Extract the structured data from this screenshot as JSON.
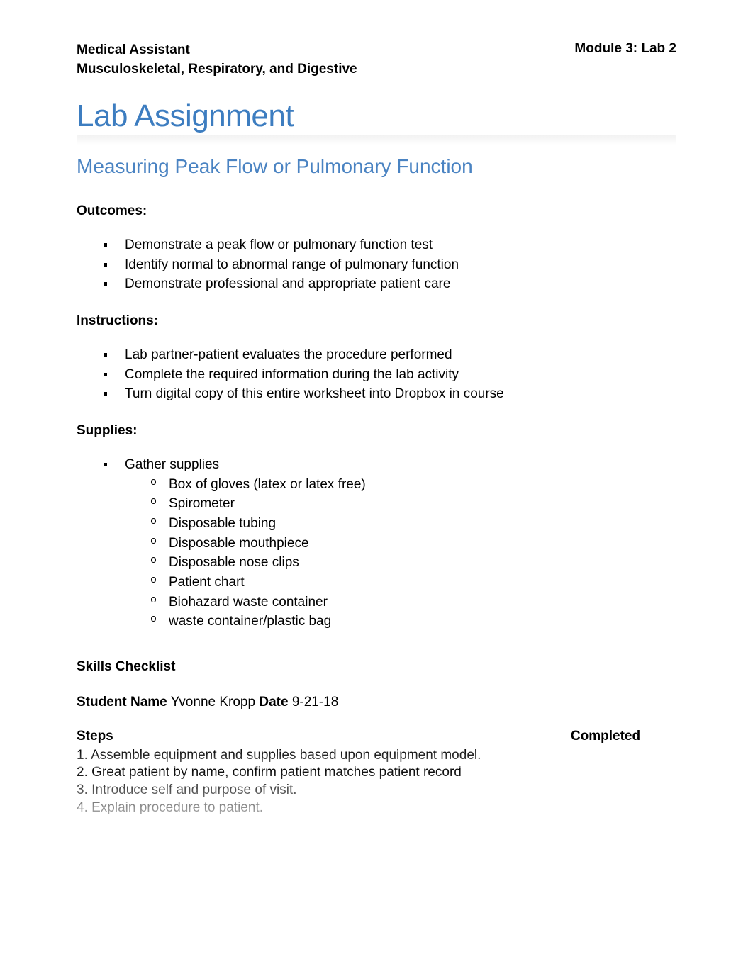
{
  "header": {
    "course_line1": "Medical Assistant",
    "course_line2": "Musculoskeletal, Respiratory, and Digestive",
    "module": "Module 3: Lab 2"
  },
  "title": "Lab Assignment",
  "subtitle": "Measuring Peak Flow or Pulmonary Function",
  "outcomes": {
    "label": "Outcomes:",
    "items": [
      "Demonstrate a peak flow or pulmonary function test",
      "Identify normal to abnormal range of pulmonary function",
      "Demonstrate professional and appropriate patient care"
    ]
  },
  "instructions": {
    "label": "Instructions:",
    "items": [
      "Lab partner-patient evaluates the procedure performed",
      "Complete the required information during the lab activity",
      "Turn digital copy of this entire worksheet into Dropbox in course"
    ]
  },
  "supplies": {
    "label": "Supplies:",
    "item": "Gather supplies",
    "subitems": [
      "Box of gloves (latex or latex free)",
      "Spirometer",
      "Disposable tubing",
      "Disposable mouthpiece",
      "Disposable nose clips",
      "Patient chart",
      "Biohazard waste container",
      "waste container/plastic bag"
    ]
  },
  "checklist": {
    "label": "Skills Checklist",
    "student_name_label": "Student Name",
    "student_name": "Yvonne Kropp",
    "date_label": "Date",
    "date": "9-21-18",
    "col_steps": "Steps",
    "col_completed": "Completed",
    "rows": [
      "1. Assemble equipment and supplies based upon equipment model.",
      "2. Great patient by name, confirm patient matches patient record",
      "3. Introduce self and purpose of visit.",
      "4. Explain procedure to patient."
    ]
  }
}
